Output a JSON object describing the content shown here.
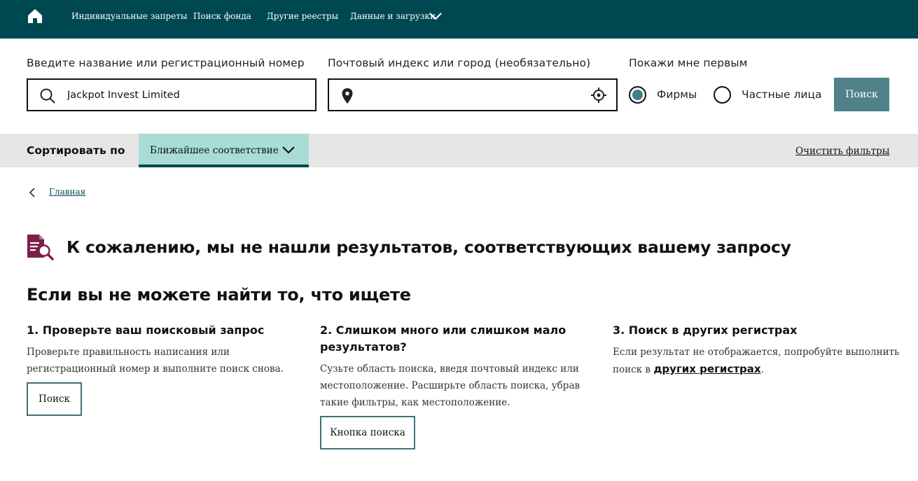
{
  "nav": {
    "items": [
      "Индивидуальные запреты",
      "Поиск фонда",
      "Другие реестры",
      "Данные и загрузки"
    ],
    "icons": {
      "home": "home-icon",
      "dropdown": "chevron-down-icon"
    }
  },
  "search": {
    "name_label": "Введите название или регистрационный номер",
    "name_value": "Jackpot Invest Limited",
    "name_placeholder": "",
    "location_label": "Почтовый индекс или город (необязательно)",
    "location_value": "",
    "show_first_label": "Покажи мне первым",
    "options": [
      {
        "label": "Фирмы",
        "selected": true
      },
      {
        "label": "Частные лица",
        "selected": false
      }
    ],
    "button": "Поиск"
  },
  "sort": {
    "label": "Сортировать по",
    "selected": "Ближайшее соответствие",
    "clear": "Очистить фильтры"
  },
  "breadcrumb": {
    "home": "Главная"
  },
  "no_results": {
    "title": "К сожалению, мы не нашли результатов, соответствующих вашему запросу",
    "subtitle": "Если вы не можете найти то, что ищете"
  },
  "tips": [
    {
      "title": "1. Проверьте ваш поисковый запрос",
      "text": "Проверьте правильность написания или регистрационный номер и выполните поиск снова.",
      "button": "Поиск"
    },
    {
      "title": "2. Слишком много или слишком мало результатов?",
      "text": "Сузьте область поиска, введя почтовый индекс или местоположение. Расширьте область поиска, убрав такие фильтры, как местоположение.",
      "button": "Кнопка поиска"
    },
    {
      "title": "3. Поиск в других регистрах",
      "text_before": "Если результат не отображается, попробуйте выполнить поиск в ",
      "link": "других регистрах",
      "text_after": "."
    }
  ],
  "colors": {
    "nav_bg": "#004851",
    "accent": "#4e8288",
    "sort_selected": "#a8dcd6",
    "radio": "#3f7f86",
    "doc_icon": "#7a1f4a"
  }
}
